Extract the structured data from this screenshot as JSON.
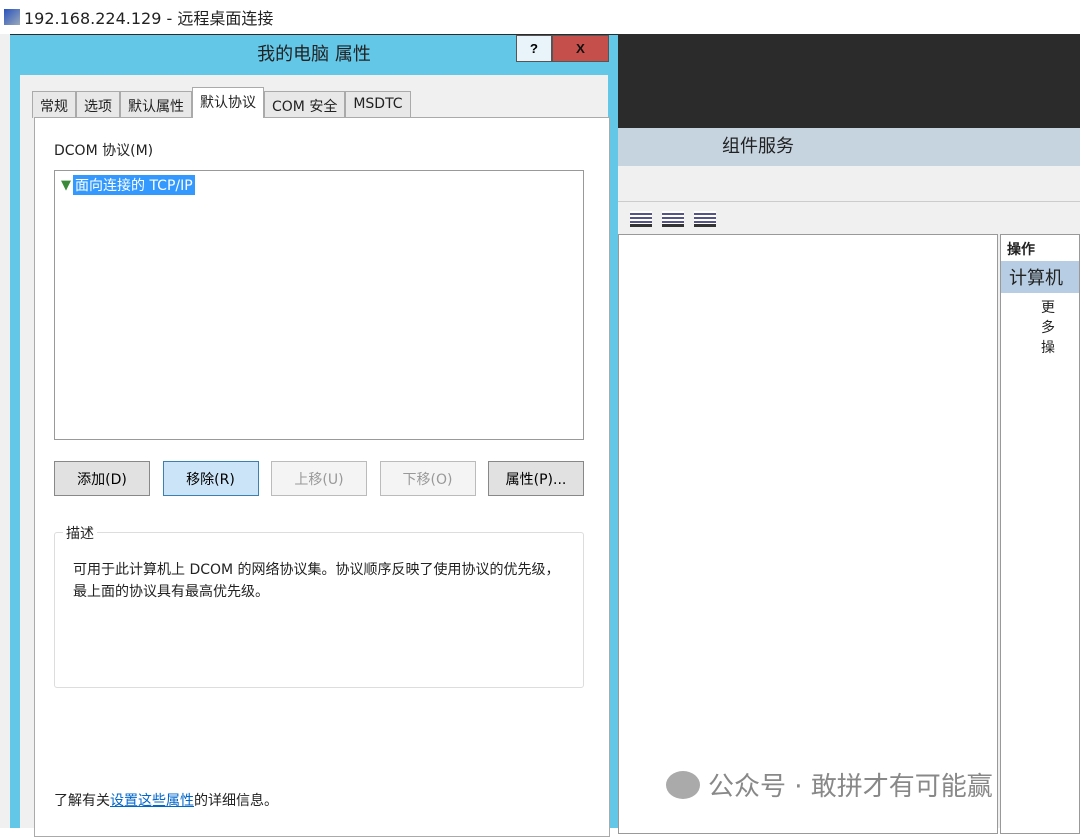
{
  "rdp": {
    "title": "192.168.224.129 - 远程桌面连接"
  },
  "background": {
    "title": "组件服务",
    "actions_header": "操作",
    "actions_selected": "计算机",
    "actions_more": "更多操"
  },
  "dialog": {
    "title": "我的电脑 属性",
    "help": "?",
    "close": "X",
    "tabs": [
      "常规",
      "选项",
      "默认属性",
      "默认协议",
      "COM 安全",
      "MSDTC"
    ],
    "protocols_label": "DCOM 协议(M)",
    "protocols": [
      "面向连接的 TCP/IP"
    ],
    "buttons": {
      "add": "添加(D)",
      "remove": "移除(R)",
      "up": "上移(U)",
      "down": "下移(O)",
      "props": "属性(P)..."
    },
    "desc_header": "描述",
    "desc_text": "可用于此计算机上 DCOM 的网络协议集。协议顺序反映了使用协议的优先级，最上面的协议具有最高优先级。",
    "info_prefix": "了解有关",
    "info_link": "设置这些属性",
    "info_suffix": "的详细信息。"
  },
  "watermark": "公众号 · 敢拼才有可能赢"
}
